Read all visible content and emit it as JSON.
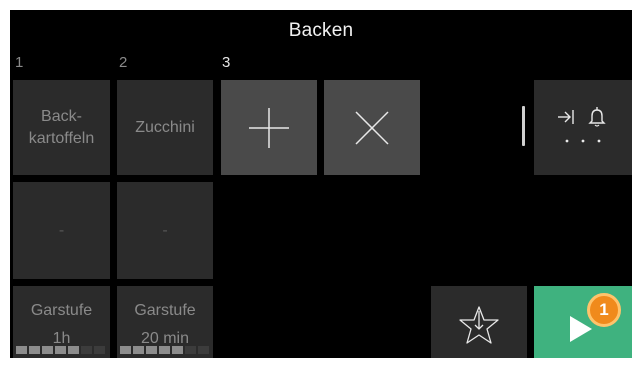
{
  "title": "Backen",
  "steps": [
    {
      "number": "1",
      "label": "Back-\nkartoffeln",
      "empty_label": "-",
      "level_label": "Garstufe",
      "level_value": "1h",
      "progress": 0.6
    },
    {
      "number": "2",
      "label": "Zucchini",
      "empty_label": "-",
      "level_label": "Garstufe",
      "level_value": "20 min",
      "progress": 0.6
    },
    {
      "number": "3"
    }
  ],
  "controls": {
    "add_icon": "plus-icon",
    "remove_icon": "close-icon",
    "timer_icons": [
      "skip-to-end-icon",
      "bell-icon",
      "more-dots-icon"
    ],
    "favorite_icon": "star-download-icon",
    "start_icon": "play-icon",
    "badge": "1"
  },
  "colors": {
    "background": "#000000",
    "tile": "#2b2b2b",
    "action_tile": "#4a4a4a",
    "start": "#3fb27f",
    "badge": "#f08a1c"
  }
}
